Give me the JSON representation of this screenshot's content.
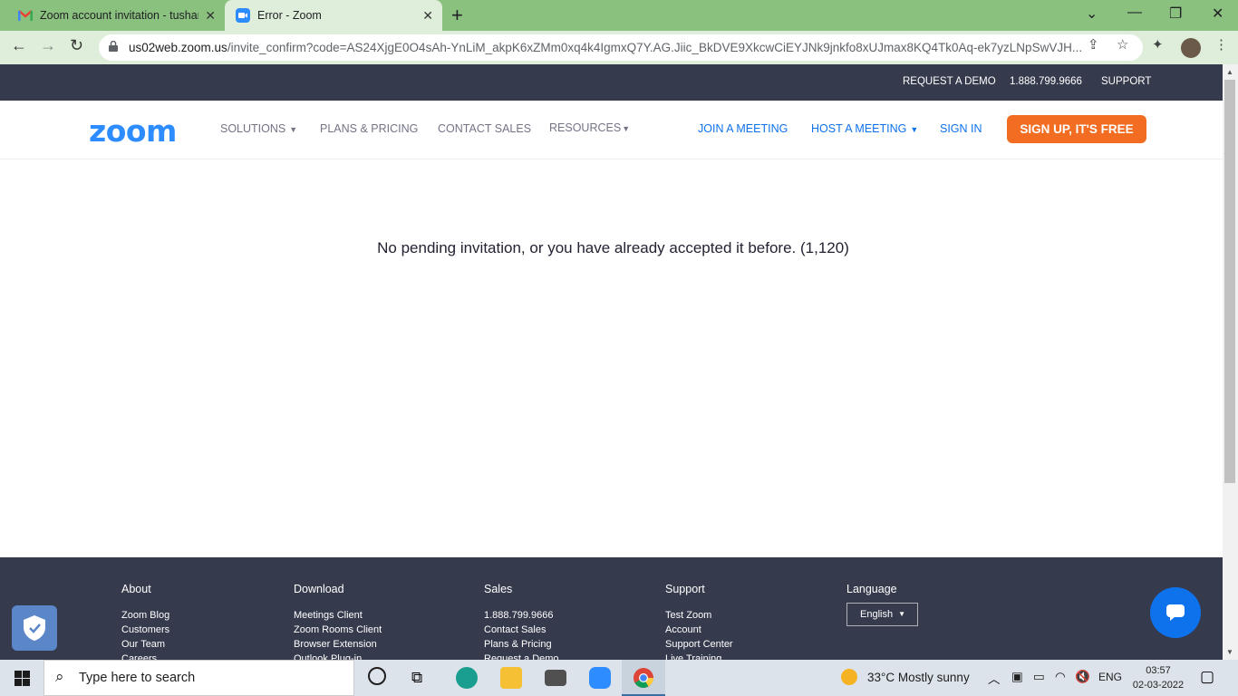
{
  "browser": {
    "tabs": [
      {
        "title": "Zoom account invitation - tushar",
        "active": false
      },
      {
        "title": "Error - Zoom",
        "active": true
      }
    ],
    "url_host": "us02web.zoom.us",
    "url_rest": "/invite_confirm?code=AS24XjgE0O4sAh-YnLiM_akpK6xZMm0xq4k4IgmxQ7Y.AG.Jiic_BkDVE9XkcwCiEYJNk9jnkfo8xUJmax8KQ4Tk0Aq-ek7yzLNpSwVJH..."
  },
  "topbar": {
    "request_demo": "REQUEST A DEMO",
    "phone": "1.888.799.9666",
    "support": "SUPPORT"
  },
  "nav": {
    "logo": "zoom",
    "solutions": "SOLUTIONS",
    "plans": "PLANS & PRICING",
    "contact": "CONTACT SALES",
    "resources": "RESOURCES",
    "join": "JOIN A MEETING",
    "host": "HOST A MEETING",
    "signin": "SIGN IN",
    "signup": "SIGN UP, IT'S FREE"
  },
  "main": {
    "message": "No pending invitation, or you have already accepted it before. (1,120)"
  },
  "footer": {
    "about": {
      "title": "About",
      "items": [
        "Zoom Blog",
        "Customers",
        "Our Team",
        "Careers"
      ]
    },
    "download": {
      "title": "Download",
      "items": [
        "Meetings Client",
        "Zoom Rooms Client",
        "Browser Extension",
        "Outlook Plug-in"
      ]
    },
    "sales": {
      "title": "Sales",
      "items": [
        "1.888.799.9666",
        "Contact Sales",
        "Plans & Pricing",
        "Request a Demo"
      ]
    },
    "support": {
      "title": "Support",
      "items": [
        "Test Zoom",
        "Account",
        "Support Center",
        "Live Training"
      ]
    },
    "language": {
      "title": "Language",
      "selected": "English"
    }
  },
  "taskbar": {
    "search_placeholder": "Type here to search",
    "weather": "33°C  Mostly sunny",
    "lang": "ENG",
    "time": "03:57",
    "date": "02-03-2022"
  },
  "colors": {
    "zoom_blue": "#2d8cff",
    "signup_orange": "#f26d21",
    "topbar_dark": "#363a4d",
    "tab_green": "#8bc17f"
  }
}
